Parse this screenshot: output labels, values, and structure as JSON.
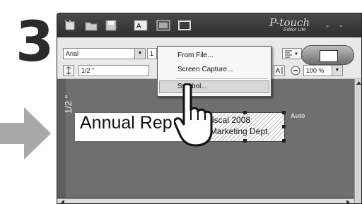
{
  "step_number": "3",
  "window": {
    "brand": "P-touch",
    "brand_sub": "Editor Lite",
    "controls": "- -"
  },
  "toolbar": {
    "font_name": "Arial",
    "font_size_partial": "1",
    "tape_width": "1/2 \"",
    "zoom": "100 %"
  },
  "insert_menu": {
    "items": [
      "From File...",
      "Screen Capture...",
      "Symbol..."
    ],
    "highlighted": "Symbol..."
  },
  "canvas": {
    "tape_side_label": "1/2 \"",
    "label_text": "Annual Rep",
    "text_block_line1": "iscal 2008",
    "text_block_line2": "Marketing Dept.",
    "length_mode": "Auto"
  }
}
